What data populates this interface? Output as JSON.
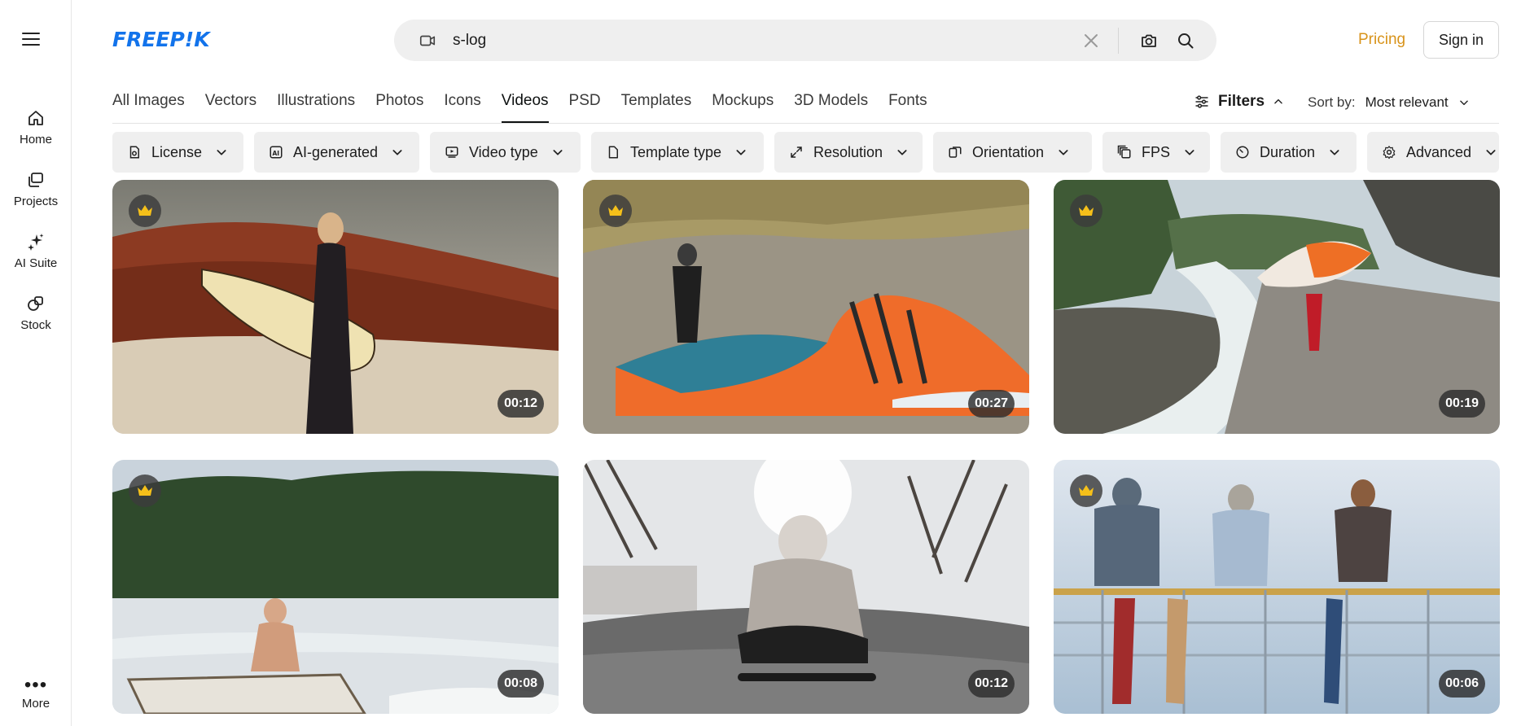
{
  "brand": {
    "logo_text": "FREEP!K",
    "color": "#1273eb"
  },
  "rail": {
    "items": [
      {
        "label": "Home",
        "icon": "home-icon"
      },
      {
        "label": "Projects",
        "icon": "projects-icon"
      },
      {
        "label": "AI Suite",
        "icon": "sparkles-icon"
      },
      {
        "label": "Stock",
        "icon": "stock-icon"
      }
    ],
    "more_label": "More"
  },
  "search": {
    "value": "s-log",
    "type_icon": "video-icon"
  },
  "header": {
    "pricing": "Pricing",
    "signin": "Sign in",
    "pricing_color": "#d8931a"
  },
  "tabs": [
    {
      "label": "All Images",
      "active": false
    },
    {
      "label": "Vectors",
      "active": false
    },
    {
      "label": "Illustrations",
      "active": false
    },
    {
      "label": "Photos",
      "active": false
    },
    {
      "label": "Icons",
      "active": false
    },
    {
      "label": "Videos",
      "active": true
    },
    {
      "label": "PSD",
      "active": false
    },
    {
      "label": "Templates",
      "active": false
    },
    {
      "label": "Mockups",
      "active": false
    },
    {
      "label": "3D Models",
      "active": false
    },
    {
      "label": "Fonts",
      "active": false
    }
  ],
  "filters": {
    "label": "Filters"
  },
  "sort": {
    "label": "Sort by:",
    "value": "Most relevant"
  },
  "chips": [
    {
      "label": "License",
      "icon": "license-icon"
    },
    {
      "label": "AI-generated",
      "icon": "ai-icon"
    },
    {
      "label": "Video type",
      "icon": "video-type-icon"
    },
    {
      "label": "Template type",
      "icon": "template-icon"
    },
    {
      "label": "Resolution",
      "icon": "resolution-icon"
    },
    {
      "label": "Orientation",
      "icon": "orientation-icon"
    },
    {
      "label": "FPS",
      "icon": "fps-icon"
    },
    {
      "label": "Duration",
      "icon": "duration-icon"
    },
    {
      "label": "Advanced",
      "icon": "gear-icon"
    }
  ],
  "results": [
    {
      "duration": "00:12",
      "premium": true,
      "scene": "surfer-woman-red-cliffs"
    },
    {
      "duration": "00:27",
      "premium": true,
      "scene": "kitesurfer-orange-kite-dunes"
    },
    {
      "duration": "00:19",
      "premium": true,
      "scene": "person-carrying-board-river-road"
    },
    {
      "duration": "00:08",
      "premium": true,
      "scene": "man-in-boat-frozen-lake"
    },
    {
      "duration": "00:12",
      "premium": false,
      "scene": "skater-sitting-skatepark"
    },
    {
      "duration": "00:06",
      "premium": true,
      "scene": "three-people-on-railing-sea"
    }
  ]
}
